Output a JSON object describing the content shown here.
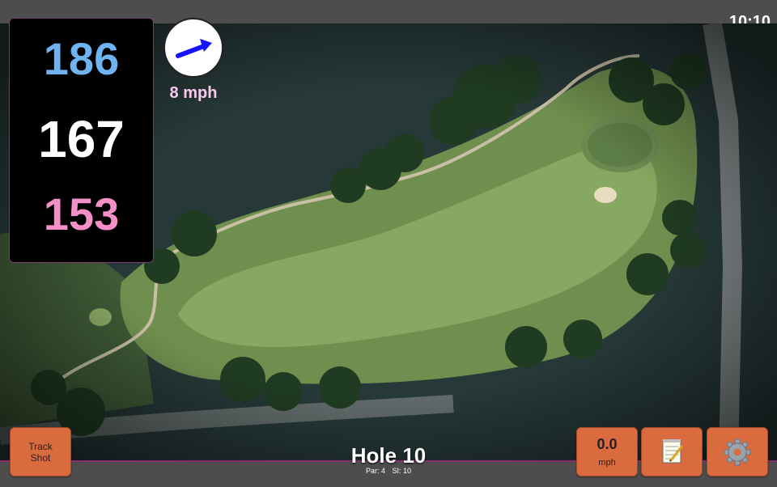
{
  "status": {
    "time": "10:10"
  },
  "distances": {
    "back": "186",
    "middle": "167",
    "front": "153",
    "back_color": "#6fb3f0",
    "middle_color": "#ffffff",
    "front_color": "#f58fc8"
  },
  "wind": {
    "speed_label": "8 mph",
    "arrow_icon": "arrow-right-icon",
    "label_color": "#f9c8ee",
    "arrow_color": "#1414ff"
  },
  "hole": {
    "title": "Hole 10",
    "par": "Par: 4",
    "si": "SI: 10"
  },
  "buttons": {
    "track_shot_line1": "Track",
    "track_shot_line2": "Shot",
    "speed_value": "0.0",
    "speed_unit": "mph",
    "notes_icon": "notepad-icon",
    "settings_icon": "gear-icon",
    "button_color": "#d96b3f"
  }
}
